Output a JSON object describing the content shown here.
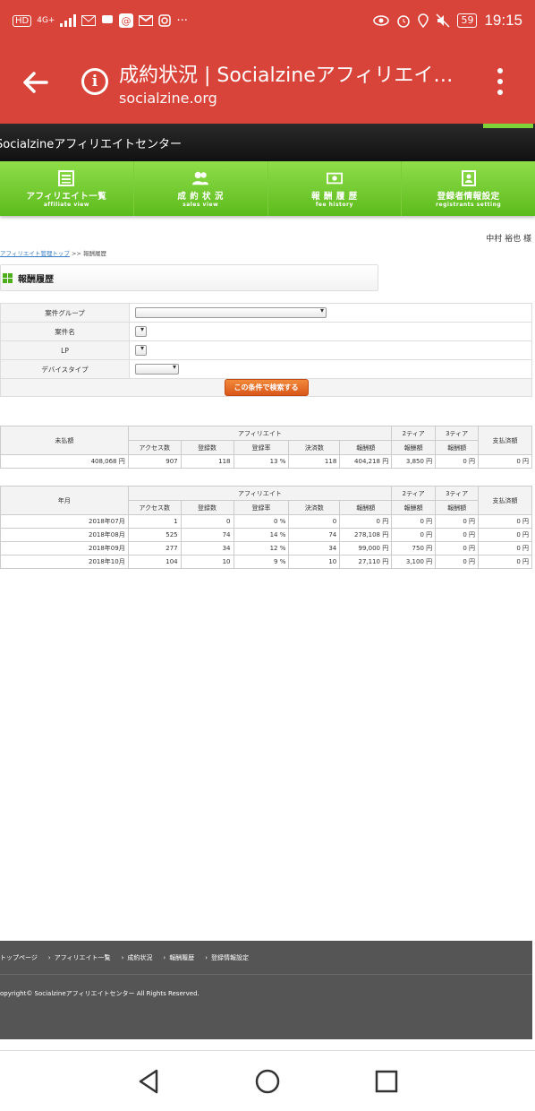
{
  "status_bar": {
    "network": "HD",
    "signal": "4G+",
    "battery": "59",
    "time": "19:15"
  },
  "browser": {
    "title": "成約状況 | Socialzineアフィリエイ…",
    "url": "socialzine.org"
  },
  "site": {
    "header_title": "Socialzineアフィリエイトセンター",
    "nav": [
      {
        "label": "アフィリエイト一覧",
        "sub": "affiliate view",
        "icon": "list-icon"
      },
      {
        "label": "成 約 状 況",
        "sub": "sales view",
        "icon": "users-icon"
      },
      {
        "label": "報 酬 履 歴",
        "sub": "fee history",
        "icon": "money-icon"
      },
      {
        "label": "登録者情報設定",
        "sub": "registrants setting",
        "icon": "profile-icon"
      }
    ],
    "user_name": "中村 裕也 様",
    "breadcrumb": {
      "link": "アフィリエイト管理トップ",
      "sep": ">>",
      "current": "報酬履歴"
    }
  },
  "section_title": "報酬履歴",
  "form": {
    "rows": [
      {
        "label": "案件グループ",
        "value": ""
      },
      {
        "label": "案件名",
        "value": ""
      },
      {
        "label": "LP",
        "value": ""
      },
      {
        "label": "デバイスタイプ",
        "value": ""
      }
    ],
    "search_button": "この条件で検索する"
  },
  "table_headers": {
    "affiliate": "アフィリエイト",
    "tier2": "2ティア",
    "tier3": "3ティア",
    "paid": "支払済額",
    "access": "アクセス数",
    "registrations": "登録数",
    "reg_rate": "登録率",
    "settled": "決済数",
    "reward": "報酬額",
    "unpaid": "未払額",
    "month": "年月"
  },
  "summary": {
    "unpaid": "408,068 円",
    "access": "907",
    "registrations": "118",
    "reg_rate": "13 %",
    "settled": "118",
    "reward": "404,218 円",
    "tier2": "3,850 円",
    "tier3": "0 円",
    "paid": "0 円"
  },
  "monthly": [
    {
      "month": "2018年07月",
      "access": "1",
      "registrations": "0",
      "reg_rate": "0 %",
      "settled": "0",
      "reward": "0 円",
      "tier2": "0 円",
      "tier3": "0 円",
      "paid": "0 円"
    },
    {
      "month": "2018年08月",
      "access": "525",
      "registrations": "74",
      "reg_rate": "14 %",
      "settled": "74",
      "reward": "278,108 円",
      "tier2": "0 円",
      "tier3": "0 円",
      "paid": "0 円"
    },
    {
      "month": "2018年09月",
      "access": "277",
      "registrations": "34",
      "reg_rate": "12 %",
      "settled": "34",
      "reward": "99,000 円",
      "tier2": "750 円",
      "tier3": "0 円",
      "paid": "0 円"
    },
    {
      "month": "2018年10月",
      "access": "104",
      "registrations": "10",
      "reg_rate": "9 %",
      "settled": "10",
      "reward": "27,110 円",
      "tier2": "3,100 円",
      "tier3": "0 円",
      "paid": "0 円"
    }
  ],
  "footer": {
    "links": [
      "トップページ",
      "アフィリエイト一覧",
      "成約状況",
      "報酬履歴",
      "登録情報設定"
    ],
    "copyright": "opyright© Socialzineアフィリエイトセンター All Rights Reserved."
  },
  "colors": {
    "chrome": "#d9443a",
    "nav_green": "#6cc62a",
    "button_orange": "#e06a22",
    "footer": "#555555"
  }
}
